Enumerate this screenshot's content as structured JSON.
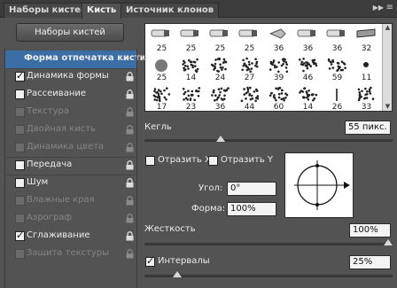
{
  "tabs": [
    {
      "label": "Наборы кистей"
    },
    {
      "label": "Кисть"
    },
    {
      "label": "Источник клонов"
    }
  ],
  "tab_menu_icon": "panel-menu-icon",
  "presets_button": "Наборы кистей",
  "options": [
    {
      "label": "Форма отпечатка кисти",
      "checkbox": false,
      "checked": false,
      "enabled": true,
      "selected": true,
      "lock": false
    },
    {
      "label": "Динамика формы",
      "checkbox": true,
      "checked": true,
      "enabled": true,
      "lock": true
    },
    {
      "label": "Рассеивание",
      "checkbox": true,
      "checked": false,
      "enabled": true,
      "lock": true
    },
    {
      "label": "Текстура",
      "checkbox": true,
      "checked": false,
      "enabled": false,
      "lock": true
    },
    {
      "label": "Двойная кисть",
      "checkbox": true,
      "checked": false,
      "enabled": false,
      "lock": true
    },
    {
      "label": "Динамика цвета",
      "checkbox": true,
      "checked": false,
      "enabled": false,
      "lock": true
    },
    {
      "label": "Передача",
      "checkbox": true,
      "checked": false,
      "enabled": true,
      "lock": true
    },
    {
      "label": "Шум",
      "checkbox": true,
      "checked": false,
      "enabled": true,
      "lock": true
    },
    {
      "label": "Влажные края",
      "checkbox": true,
      "checked": false,
      "enabled": false,
      "lock": true
    },
    {
      "label": "Аэрограф",
      "checkbox": true,
      "checked": false,
      "enabled": false,
      "lock": true
    },
    {
      "label": "Сглаживание",
      "checkbox": true,
      "checked": true,
      "enabled": true,
      "lock": true
    },
    {
      "label": "Защита текстуры",
      "checkbox": true,
      "checked": false,
      "enabled": false,
      "lock": true
    }
  ],
  "brush_sizes": [
    [
      "25",
      "25",
      "25",
      "25",
      "36",
      "36",
      "36",
      "32"
    ],
    [
      "25",
      "14",
      "24",
      "27",
      "39",
      "46",
      "59",
      "11"
    ],
    [
      "17",
      "23",
      "36",
      "44",
      "60",
      "14",
      "26",
      "33"
    ]
  ],
  "size": {
    "label": "Кегль",
    "value": "55 пикс.",
    "level": 0.3
  },
  "flip_x": {
    "label": "Отразить X",
    "checked": false
  },
  "flip_y": {
    "label": "Отразить Y",
    "checked": false
  },
  "angle": {
    "label": "Угол:",
    "value": "0°"
  },
  "roundness": {
    "label": "Форма:",
    "value": "100%"
  },
  "hardness": {
    "label": "Жесткость",
    "value": "100%",
    "level": 1.0
  },
  "spacing": {
    "label": "Интервалы",
    "value": "25%",
    "checked": true,
    "level": 0.12
  },
  "colors": {
    "panel": "#535353",
    "selected": "#3a6ea5",
    "tabbar": "#3c3c3c"
  }
}
